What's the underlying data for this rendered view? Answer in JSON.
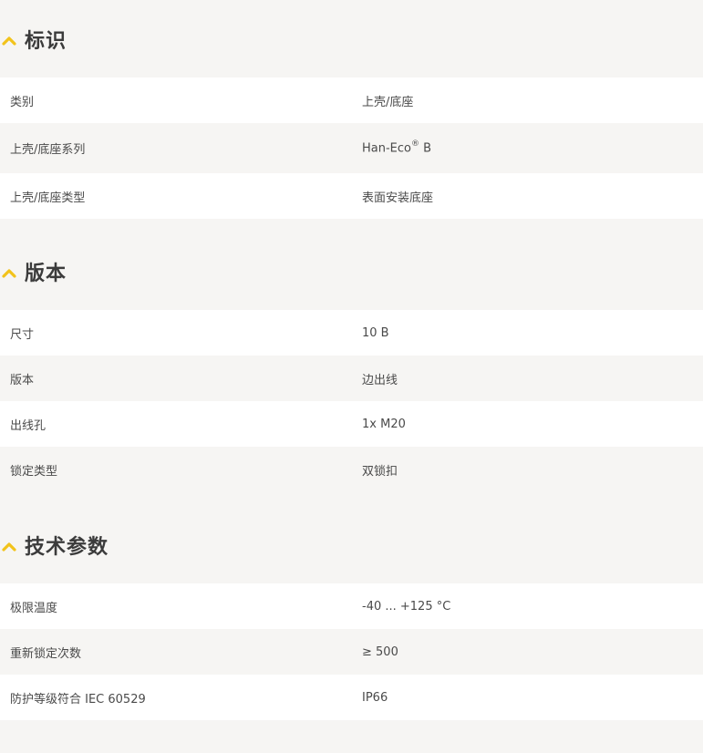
{
  "colors": {
    "accent": "#f2c31b",
    "row_white": "#ffffff",
    "row_grey": "#f6f5f3",
    "text": "#4a4a4a"
  },
  "sections": [
    {
      "title": "标识",
      "icon": "chevron-up-icon",
      "rows": [
        {
          "label": "类别",
          "value": "上壳/底座"
        },
        {
          "label": "上壳/底座系列",
          "value": "Han-Eco",
          "value_sup": "®",
          "value_suffix": " B"
        },
        {
          "label": "上壳/底座类型",
          "value": "表面安装底座"
        }
      ]
    },
    {
      "title": "版本",
      "icon": "chevron-up-icon",
      "rows": [
        {
          "label": "尺寸",
          "value": "10 B"
        },
        {
          "label": "版本",
          "value": "边出线"
        },
        {
          "label": "出线孔",
          "value": "1x M20"
        },
        {
          "label": "锁定类型",
          "value": "双锁扣"
        }
      ]
    },
    {
      "title": "技术参数",
      "icon": "chevron-up-icon",
      "rows": [
        {
          "label": "极限温度",
          "value": "-40 ... +125 °C"
        },
        {
          "label": "重新锁定次数",
          "value": "≥ 500"
        },
        {
          "label": "防护等级符合 IEC 60529",
          "value": "IP66"
        }
      ]
    }
  ]
}
